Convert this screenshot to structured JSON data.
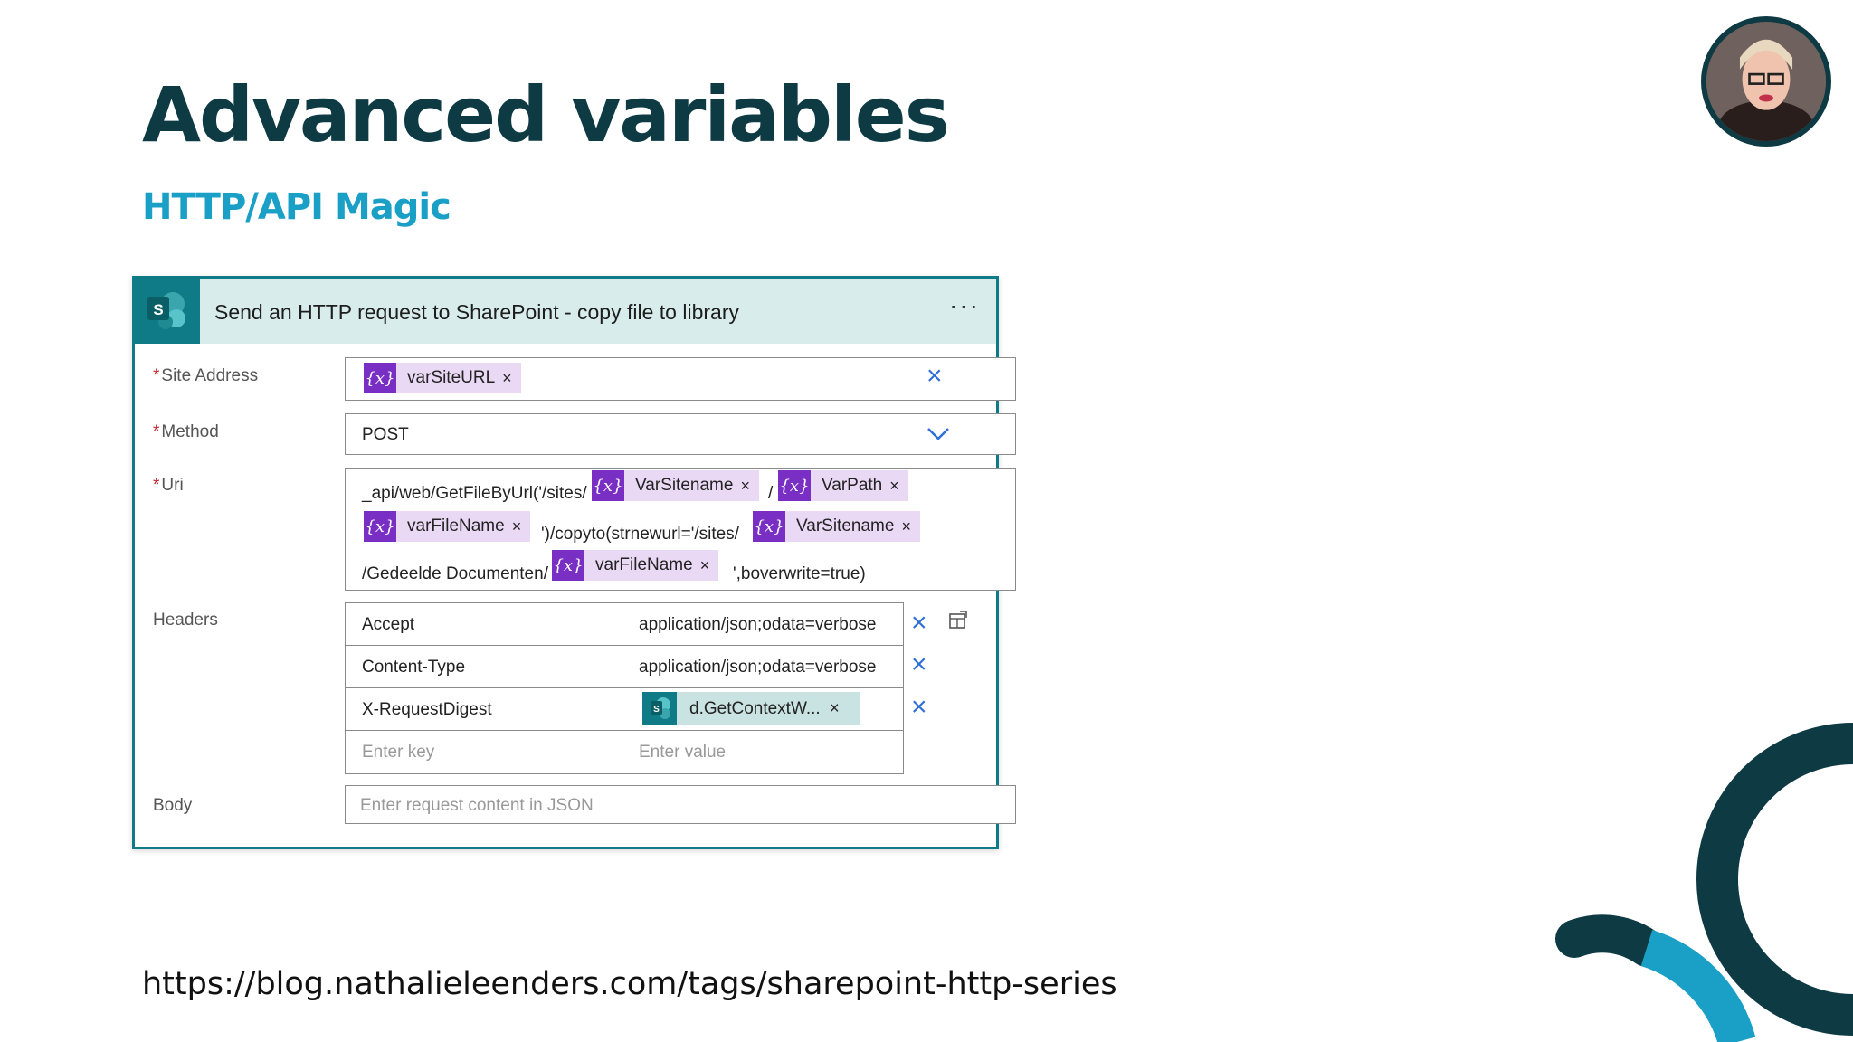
{
  "slide": {
    "title": "Advanced variables",
    "subtitle": "HTTP/API Magic",
    "url": "https://blog.nathalieleenders.com/tags/sharepoint-http-series"
  },
  "card": {
    "title": "Send an HTTP request to SharePoint - copy file to library",
    "more_label": "···",
    "site_address": {
      "label": "Site Address",
      "required": "*",
      "token": "varSiteURL"
    },
    "method": {
      "label": "Method",
      "required": "*",
      "value": "POST"
    },
    "uri": {
      "label": "Uri",
      "required": "*",
      "parts": {
        "p1": "_api/web/GetFileByUrl('/sites/",
        "t1": "VarSitename",
        "p2": "/",
        "t2": "VarPath",
        "t3": "varFileName",
        "p3": "')/copyto(strnewurl='/sites/",
        "t4": "VarSitename",
        "p4": "/Gedeelde Documenten/",
        "t5": "varFileName",
        "p5": "',boverwrite=true)"
      }
    },
    "headers": {
      "label": "Headers",
      "rows": [
        {
          "key": "Accept",
          "value": "application/json;odata=verbose"
        },
        {
          "key": "Content-Type",
          "value": "application/json;odata=verbose"
        },
        {
          "key": "X-RequestDigest",
          "value": "d.GetContextW..."
        }
      ],
      "key_placeholder": "Enter key",
      "value_placeholder": "Enter value"
    },
    "body": {
      "label": "Body",
      "placeholder": "Enter request content in JSON"
    }
  },
  "icons": {
    "variable": "{x}",
    "token_remove": "×",
    "clear": "×",
    "sharepoint": "sharepoint-icon"
  },
  "colors": {
    "title": "#0e3a44",
    "subtitle": "#1aa0c6",
    "card_border": "#0f7b86",
    "variable_icon": "#7a2fc4",
    "variable_token": "#ead9f5",
    "clear_x": "#2f6fd6"
  }
}
